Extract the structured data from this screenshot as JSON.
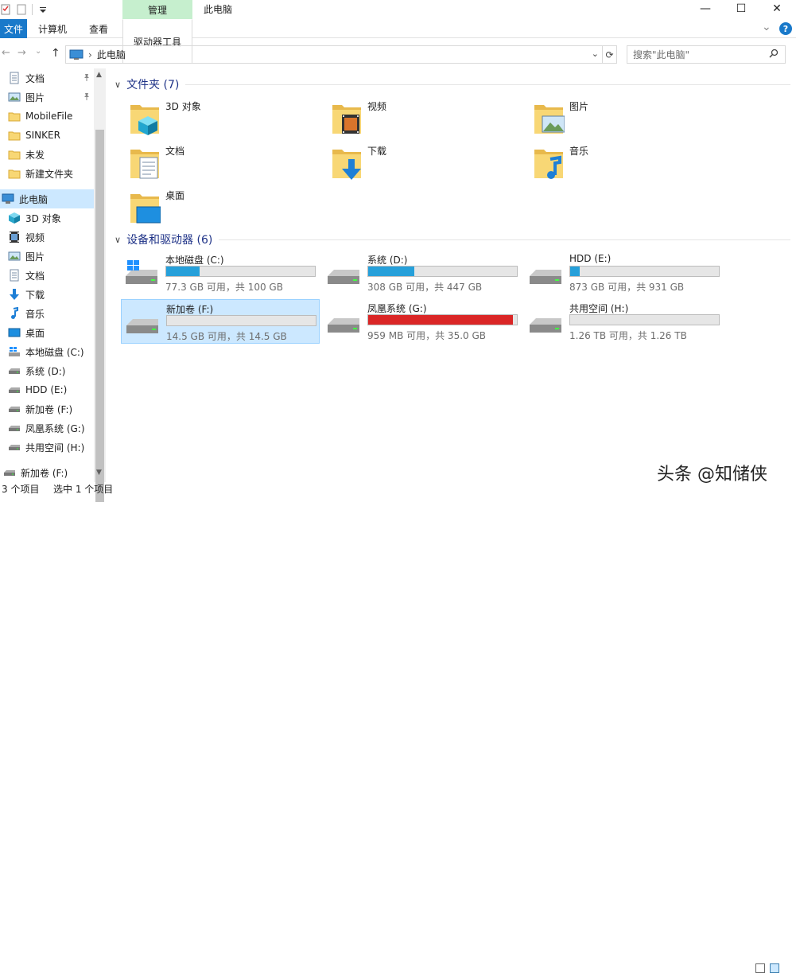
{
  "window": {
    "title": "此电脑",
    "context_tab": "管理",
    "controls": {
      "minimize": "—",
      "maximize": "☐",
      "close": "✕"
    }
  },
  "ribbon": {
    "tabs": [
      "文件",
      "计算机",
      "查看",
      "驱动器工具"
    ],
    "collapse_glyph": "⌄",
    "help_glyph": "?"
  },
  "address": {
    "back": "←",
    "forward": "→",
    "dropdown": "⌄",
    "up": "↑",
    "path_sep": "›",
    "path": "此电脑",
    "refresh": "⟳",
    "search_placeholder": "搜索\"此电脑\"",
    "search_icon": "🔍"
  },
  "nav": {
    "items": [
      {
        "label": "文档",
        "icon": "doc",
        "pinned": true
      },
      {
        "label": "图片",
        "icon": "pic",
        "pinned": true
      },
      {
        "label": "MobileFile",
        "icon": "folder",
        "pinned": false
      },
      {
        "label": "SINKER",
        "icon": "folder",
        "pinned": false
      },
      {
        "label": "未发",
        "icon": "folder",
        "pinned": false
      },
      {
        "label": "新建文件夹",
        "icon": "folder",
        "pinned": false
      },
      {
        "label": "此电脑",
        "icon": "pc",
        "pinned": false,
        "selected": true
      },
      {
        "label": "3D 对象",
        "icon": "cube",
        "pinned": false
      },
      {
        "label": "视频",
        "icon": "video",
        "pinned": false
      },
      {
        "label": "图片",
        "icon": "pic",
        "pinned": false
      },
      {
        "label": "文档",
        "icon": "doc",
        "pinned": false
      },
      {
        "label": "下载",
        "icon": "down",
        "pinned": false
      },
      {
        "label": "音乐",
        "icon": "music",
        "pinned": false
      },
      {
        "label": "桌面",
        "icon": "desk",
        "pinned": false
      },
      {
        "label": "本地磁盘 (C:)",
        "icon": "winc",
        "pinned": false
      },
      {
        "label": "系统 (D:)",
        "icon": "drive",
        "pinned": false
      },
      {
        "label": "HDD (E:)",
        "icon": "drive",
        "pinned": false
      },
      {
        "label": "新加卷 (F:)",
        "icon": "drive",
        "pinned": false
      },
      {
        "label": "凤凰系统 (G:)",
        "icon": "drive",
        "pinned": false
      },
      {
        "label": "共用空间 (H:)",
        "icon": "drive",
        "pinned": false
      },
      {
        "label": "新加卷 (F:)",
        "icon": "drive",
        "pinned": false
      }
    ],
    "pin_glyph": "📌",
    "scroll_up": "▲",
    "scroll_down": "▼"
  },
  "groups": {
    "folders_header": "文件夹 (7)",
    "drives_header": "设备和驱动器 (6)",
    "chevron": "∨"
  },
  "folders": [
    {
      "label": "3D 对象",
      "icon": "cube"
    },
    {
      "label": "视频",
      "icon": "video"
    },
    {
      "label": "图片",
      "icon": "pic"
    },
    {
      "label": "文档",
      "icon": "doc"
    },
    {
      "label": "下载",
      "icon": "down"
    },
    {
      "label": "音乐",
      "icon": "music"
    },
    {
      "label": "桌面",
      "icon": "desk"
    }
  ],
  "drives": [
    {
      "name": "本地磁盘 (C:)",
      "free": "77.3 GB 可用，共 100 GB",
      "used_fraction": 0.227,
      "windows": true,
      "selected": false,
      "critical": false
    },
    {
      "name": "系统 (D:)",
      "free": "308 GB 可用，共 447 GB",
      "used_fraction": 0.311,
      "windows": false,
      "selected": false,
      "critical": false
    },
    {
      "name": "HDD (E:)",
      "free": "873 GB 可用，共 931 GB",
      "used_fraction": 0.062,
      "windows": false,
      "selected": false,
      "critical": false
    },
    {
      "name": "新加卷 (F:)",
      "free": "14.5 GB 可用，共 14.5 GB",
      "used_fraction": 0.0,
      "windows": false,
      "selected": true,
      "critical": false
    },
    {
      "name": "凤凰系统 (G:)",
      "free": "959 MB 可用，共 35.0 GB",
      "used_fraction": 0.973,
      "windows": false,
      "selected": false,
      "critical": true
    },
    {
      "name": "共用空间 (H:)",
      "free": "1.26 TB 可用，共 1.26 TB",
      "used_fraction": 0.0,
      "windows": false,
      "selected": false,
      "critical": false
    }
  ],
  "status": {
    "count": "3 个项目",
    "selection": "选中 1 个项目"
  },
  "watermark": "头条 @知储侠",
  "colors": {
    "accent": "#1979ca",
    "bar_normal": "#26a0da",
    "bar_critical": "#da2626",
    "selection": "#cce8ff",
    "group_header": "#1e3287",
    "context_tab": "#c6efce"
  }
}
